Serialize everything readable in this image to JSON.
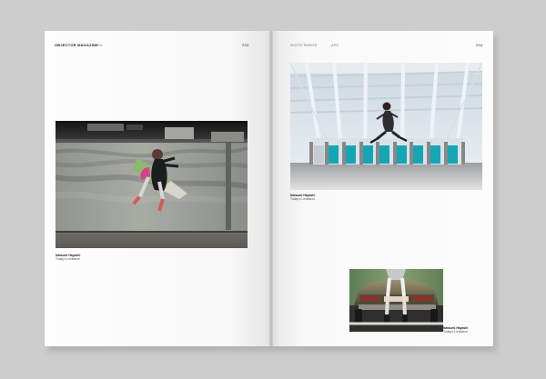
{
  "magazine": {
    "left_header": {
      "brand": "OBJECTOR MAGAZINE",
      "issue": "VOL",
      "page_number": "233"
    },
    "right_header": {
      "section": "ФОТОГРАФИЯ",
      "subsection": "ART",
      "page_number": "234"
    },
    "photos": [
      {
        "name": "Natsumi Hayashi",
        "title": "Today's Levitation"
      },
      {
        "name": "Natsumi Hayashi",
        "title": "Today's Levitation"
      },
      {
        "name": "Natsumi Hayashi",
        "title": "Today's Levitation"
      }
    ],
    "colors": {
      "background": "#cdcdcd",
      "paper": "#fbfbfb",
      "text": "#222222"
    }
  }
}
